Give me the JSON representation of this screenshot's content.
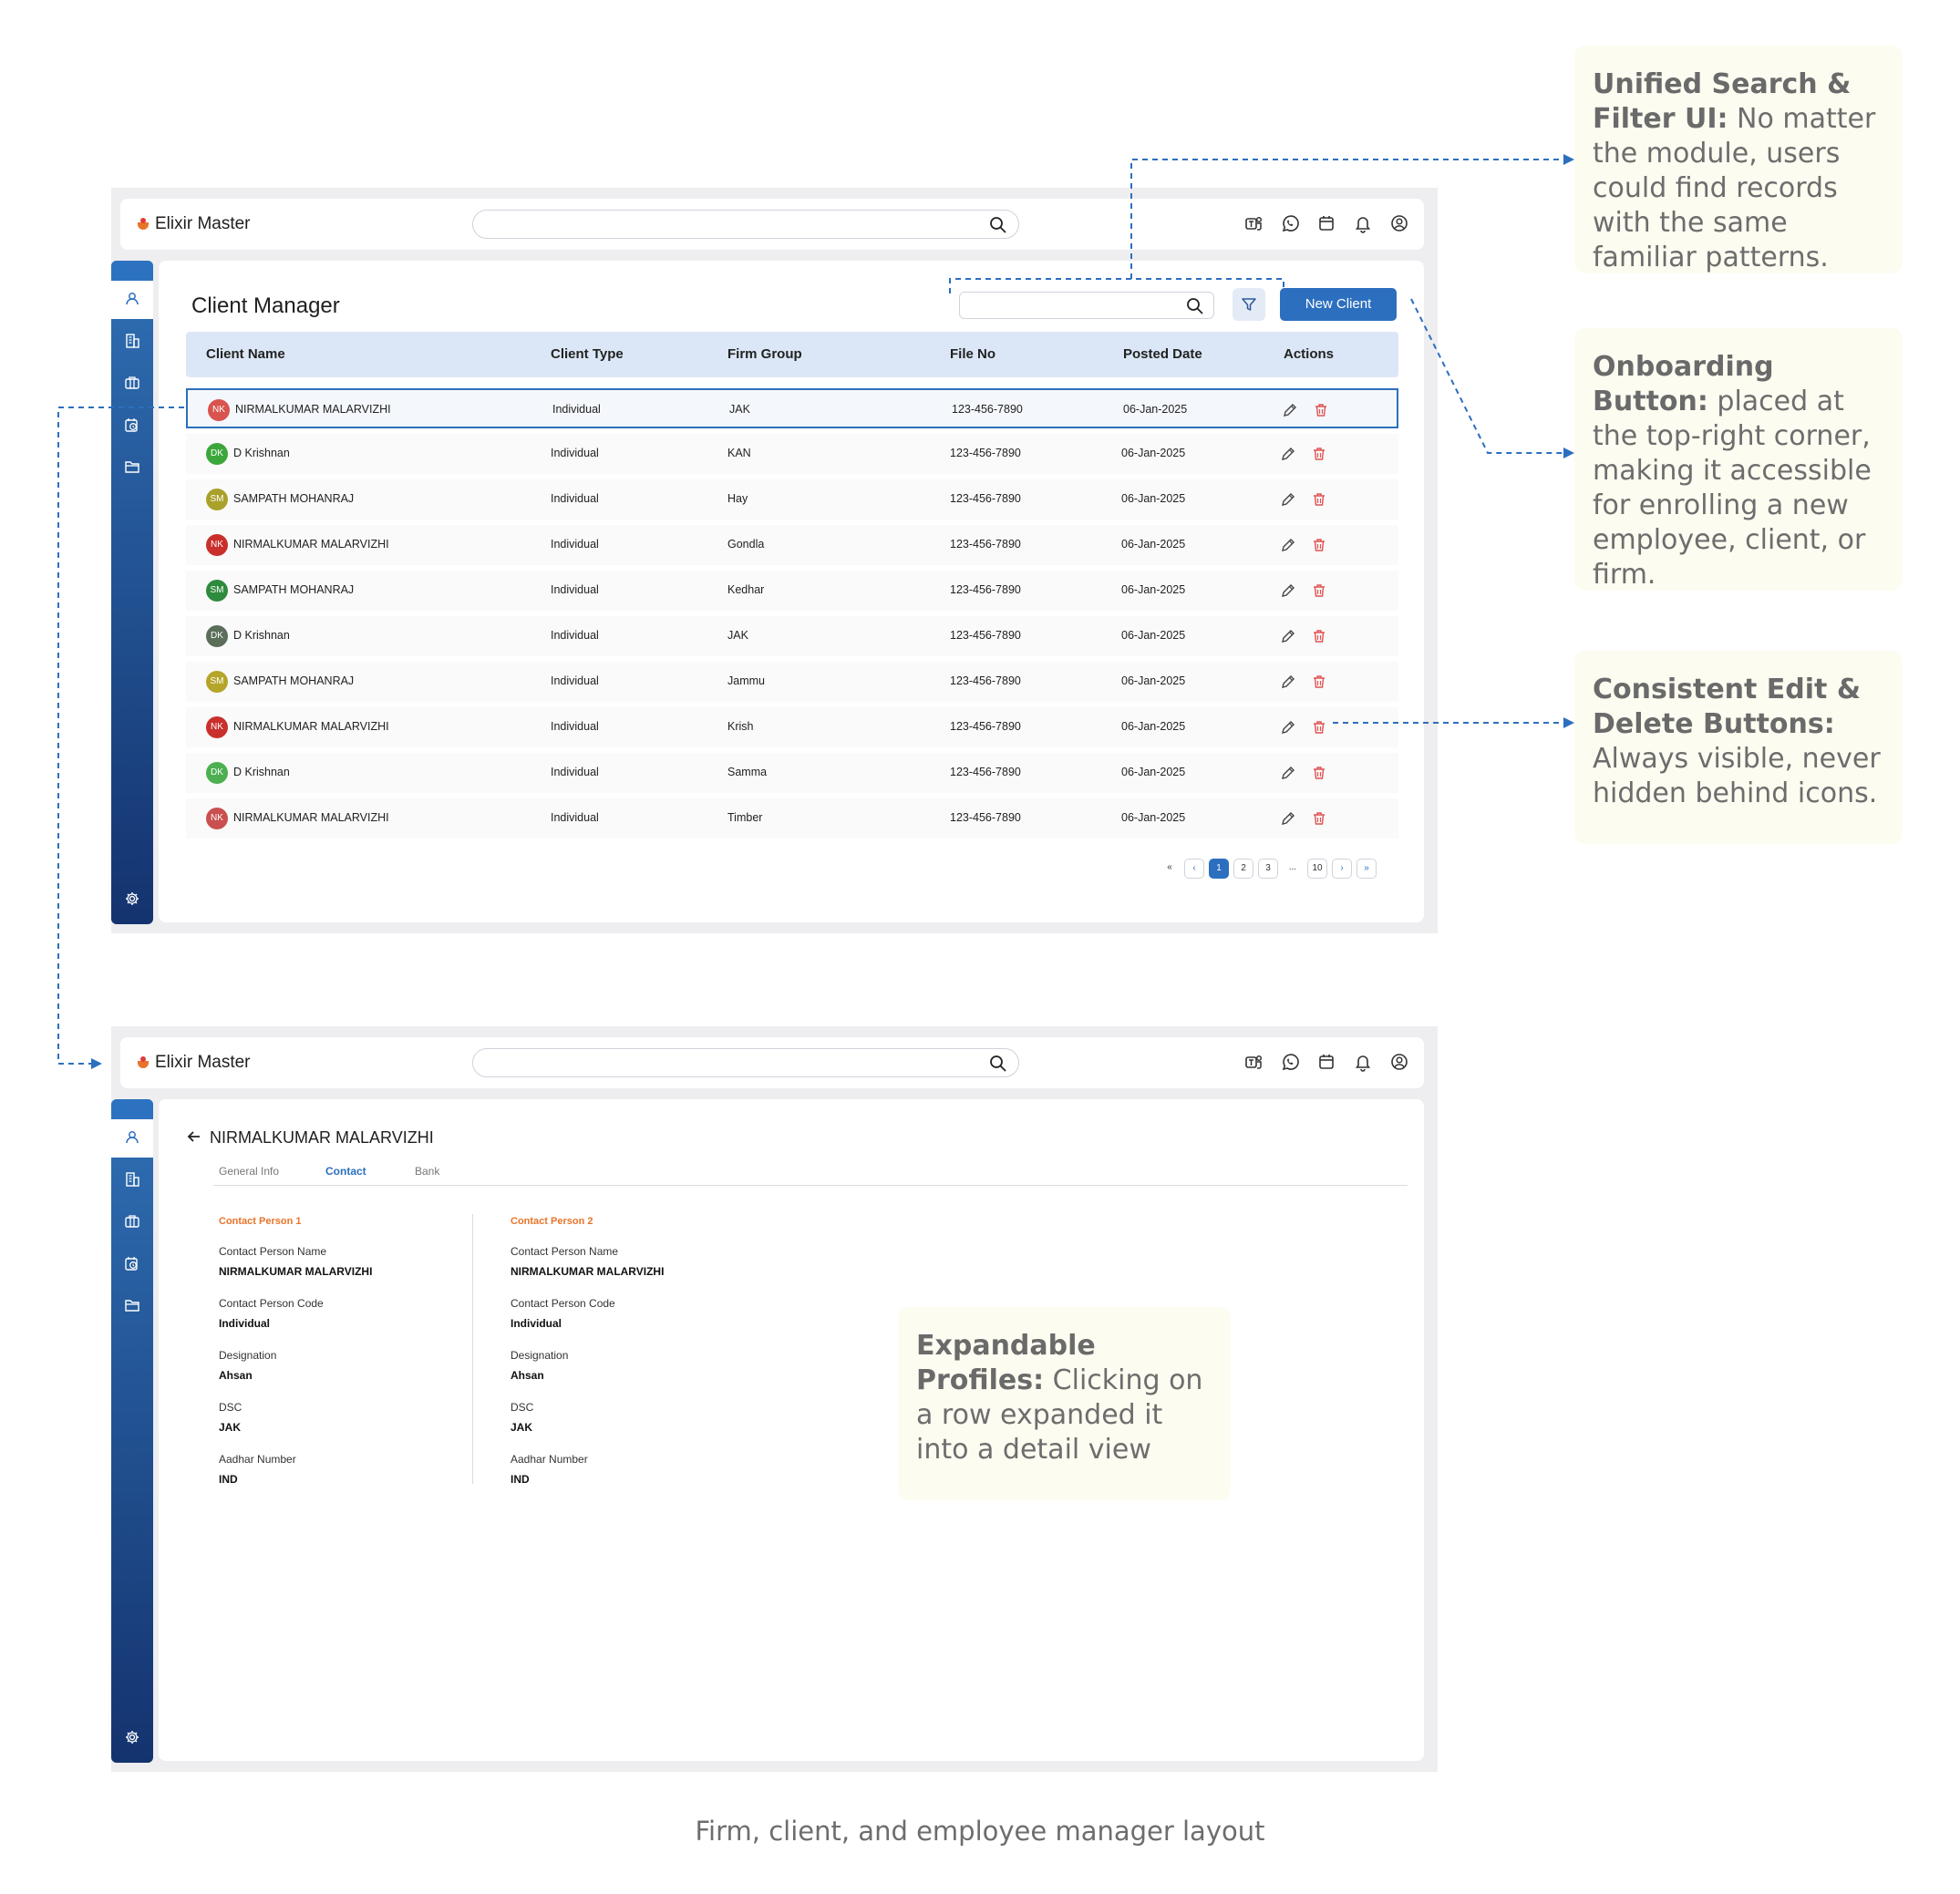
{
  "app": {
    "brand": "Elixir Master",
    "colors": {
      "primary": "#2c6fbf",
      "accent": "#e8742a",
      "delete": "#e05252",
      "header_bg": "#dbe7f6",
      "note_bg": "#fdfcf1"
    },
    "top_icons": [
      "teams-icon",
      "whatsapp-icon",
      "calendar-icon",
      "bell-icon",
      "user-circle-icon"
    ],
    "sidebar_icons": [
      "user-icon",
      "building-icon",
      "briefcase-icon",
      "time-doc-icon",
      "folder-icon",
      "settings-icon"
    ]
  },
  "client_manager": {
    "title": "Client Manager",
    "new_button": "New Client",
    "columns": [
      "Client Name",
      "Client Type",
      "Firm Group",
      "File No",
      "Posted Date",
      "Actions"
    ],
    "rows": [
      {
        "initials": "NK",
        "avatar_color": "#d9534f",
        "name": "NIRMALKUMAR MALARVIZHI",
        "type": "Individual",
        "firm": "JAK",
        "file": "123-456-7890",
        "date": "06-Jan-2025"
      },
      {
        "initials": "DK",
        "avatar_color": "#3ba73b",
        "name": "D Krishnan",
        "type": "Individual",
        "firm": "KAN",
        "file": "123-456-7890",
        "date": "06-Jan-2025"
      },
      {
        "initials": "SM",
        "avatar_color": "#a9a12a",
        "name": "SAMPATH MOHANRAJ",
        "type": "Individual",
        "firm": "Hay",
        "file": "123-456-7890",
        "date": "06-Jan-2025"
      },
      {
        "initials": "NK",
        "avatar_color": "#c9302c",
        "name": "NIRMALKUMAR MALARVIZHI",
        "type": "Individual",
        "firm": "Gondla",
        "file": "123-456-7890",
        "date": "06-Jan-2025"
      },
      {
        "initials": "SM",
        "avatar_color": "#2e8b3e",
        "name": "SAMPATH MOHANRAJ",
        "type": "Individual",
        "firm": "Kedhar",
        "file": "123-456-7890",
        "date": "06-Jan-2025"
      },
      {
        "initials": "DK",
        "avatar_color": "#5a6e5a",
        "name": "D Krishnan",
        "type": "Individual",
        "firm": "JAK",
        "file": "123-456-7890",
        "date": "06-Jan-2025"
      },
      {
        "initials": "SM",
        "avatar_color": "#b5a52a",
        "name": "SAMPATH MOHANRAJ",
        "type": "Individual",
        "firm": "Jammu",
        "file": "123-456-7890",
        "date": "06-Jan-2025"
      },
      {
        "initials": "NK",
        "avatar_color": "#c9302c",
        "name": "NIRMALKUMAR MALARVIZHI",
        "type": "Individual",
        "firm": "Krish",
        "file": "123-456-7890",
        "date": "06-Jan-2025"
      },
      {
        "initials": "DK",
        "avatar_color": "#4caf50",
        "name": "D Krishnan",
        "type": "Individual",
        "firm": "Samma",
        "file": "123-456-7890",
        "date": "06-Jan-2025"
      },
      {
        "initials": "NK",
        "avatar_color": "#c9504f",
        "name": "NIRMALKUMAR MALARVIZHI",
        "type": "Individual",
        "firm": "Timber",
        "file": "123-456-7890",
        "date": "06-Jan-2025"
      }
    ],
    "pagination": {
      "first": "«",
      "prev": "‹",
      "pages": [
        "1",
        "2",
        "3"
      ],
      "ellipsis": "...",
      "last_page": "10",
      "next": "›",
      "last": "»",
      "current": "1"
    }
  },
  "detail": {
    "name": "NIRMALKUMAR MALARVIZHI",
    "tabs": [
      "General Info",
      "Contact",
      "Bank"
    ],
    "active_tab": "Contact",
    "contact1": {
      "title": "Contact Person 1",
      "fields": [
        {
          "label": "Contact Person Name",
          "value": "NIRMALKUMAR MALARVIZHI"
        },
        {
          "label": "Contact Person Code",
          "value": "Individual"
        },
        {
          "label": "Designation",
          "value": "Ahsan"
        },
        {
          "label": "DSC",
          "value": "JAK"
        },
        {
          "label": "Aadhar Number",
          "value": "IND"
        }
      ]
    },
    "contact2": {
      "title": "Contact Person 2",
      "fields": [
        {
          "label": "Contact Person Name",
          "value": "NIRMALKUMAR MALARVIZHI"
        },
        {
          "label": "Contact Person Code",
          "value": "Individual"
        },
        {
          "label": "Designation",
          "value": "Ahsan"
        },
        {
          "label": "DSC",
          "value": "JAK"
        },
        {
          "label": "Aadhar Number",
          "value": "IND"
        }
      ]
    }
  },
  "notes": {
    "search": {
      "title": "Unified Search & Filter UI:",
      "body": " No matter the module, users could find records with the same familiar patterns."
    },
    "onboarding": {
      "title": "Onboarding Button:",
      "body": " placed at the top-right corner, making it accessible for enrolling a new employee, client, or firm."
    },
    "edit_delete": {
      "title": "Consistent Edit & Delete Buttons:",
      "body": " Always visible, never hidden behind icons."
    },
    "expandable": {
      "title": "Expandable Profiles:",
      "body": " Clicking on a row expanded it into a detail view"
    }
  },
  "caption": "Firm, client, and employee manager layout"
}
